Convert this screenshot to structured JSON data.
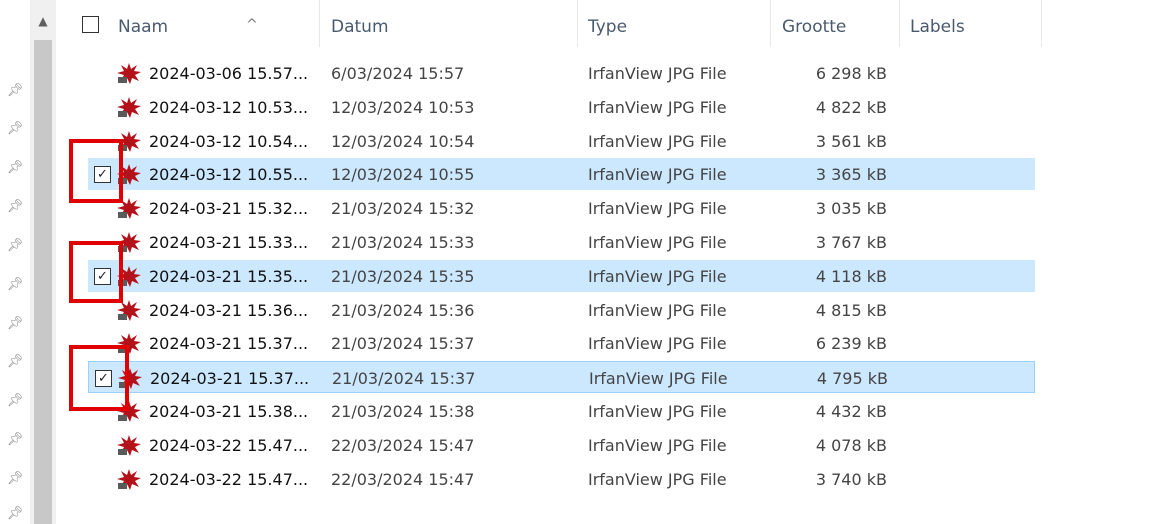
{
  "colors": {
    "selection": "#cce8ff",
    "highlight_box": "#e00000"
  },
  "columns": {
    "name": "Naam",
    "date": "Datum",
    "type": "Type",
    "size": "Grootte",
    "labels": "Labels",
    "sort_indicator": "^"
  },
  "files": [
    {
      "name": "2024-03-06 15.57...",
      "date": "6/03/2024 15:57",
      "type": "IrfanView JPG File",
      "size": "6 298 kB",
      "selected": false,
      "icon": "irfanview-jpg-icon"
    },
    {
      "name": "2024-03-12 10.53...",
      "date": "12/03/2024 10:53",
      "type": "IrfanView JPG File",
      "size": "4 822 kB",
      "selected": false,
      "icon": "irfanview-jpg-icon"
    },
    {
      "name": "2024-03-12 10.54...",
      "date": "12/03/2024 10:54",
      "type": "IrfanView JPG File",
      "size": "3 561 kB",
      "selected": false,
      "icon": "irfanview-jpg-icon"
    },
    {
      "name": "2024-03-12 10.55...",
      "date": "12/03/2024 10:55",
      "type": "IrfanView JPG File",
      "size": "3 365 kB",
      "selected": true,
      "icon": "irfanview-jpg-icon"
    },
    {
      "name": "2024-03-21 15.32...",
      "date": "21/03/2024 15:32",
      "type": "IrfanView JPG File",
      "size": "3 035 kB",
      "selected": false,
      "icon": "irfanview-jpg-icon"
    },
    {
      "name": "2024-03-21 15.33...",
      "date": "21/03/2024 15:33",
      "type": "IrfanView JPG File",
      "size": "3 767 kB",
      "selected": false,
      "icon": "irfanview-jpg-icon"
    },
    {
      "name": "2024-03-21 15.35...",
      "date": "21/03/2024 15:35",
      "type": "IrfanView JPG File",
      "size": "4 118 kB",
      "selected": true,
      "icon": "irfanview-jpg-icon"
    },
    {
      "name": "2024-03-21 15.36...",
      "date": "21/03/2024 15:36",
      "type": "IrfanView JPG File",
      "size": "4 815 kB",
      "selected": false,
      "icon": "irfanview-jpg-icon"
    },
    {
      "name": "2024-03-21 15.37...",
      "date": "21/03/2024 15:37",
      "type": "IrfanView JPG File",
      "size": "6 239 kB",
      "selected": false,
      "icon": "irfanview-jpg-icon"
    },
    {
      "name": "2024-03-21 15.37...",
      "date": "21/03/2024 15:37",
      "type": "IrfanView JPG File",
      "size": "4 795 kB",
      "selected": true,
      "icon": "irfanview-jpg-icon"
    },
    {
      "name": "2024-03-21 15.38...",
      "date": "21/03/2024 15:38",
      "type": "IrfanView JPG File",
      "size": "4 432 kB",
      "selected": false,
      "icon": "irfanview-jpg-icon"
    },
    {
      "name": "2024-03-22 15.47...",
      "date": "22/03/2024 15:47",
      "type": "IrfanView JPG File",
      "size": "4 078 kB",
      "selected": false,
      "icon": "irfanview-jpg-icon"
    },
    {
      "name": "2024-03-22 15.47...",
      "date": "22/03/2024 15:47",
      "type": "IrfanView JPG File",
      "size": "3 740 kB",
      "selected": false,
      "icon": "irfanview-jpg-icon"
    }
  ]
}
